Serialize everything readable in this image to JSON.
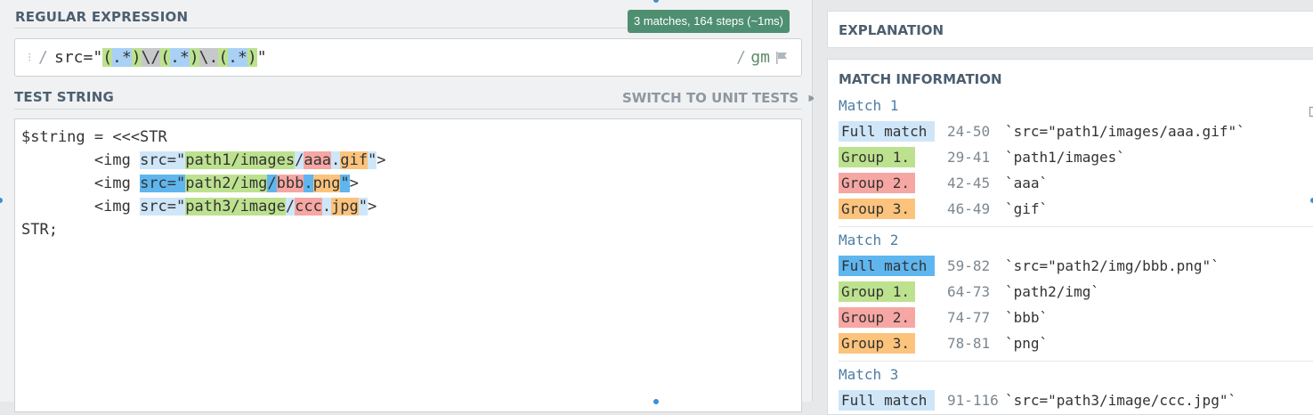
{
  "regex_section": {
    "label": "REGULAR EXPRESSION",
    "match_badge": "3 matches, 164 steps (~1ms)",
    "delimiter_open": "/",
    "delimiter_close": "/",
    "pattern_parts": [
      {
        "text": "src=\"",
        "style": "plain"
      },
      {
        "text": "(",
        "style": "green"
      },
      {
        "text": ".*",
        "style": "blue"
      },
      {
        "text": ")",
        "style": "green"
      },
      {
        "text": "\\/",
        "style": "gray"
      },
      {
        "text": "(",
        "style": "green"
      },
      {
        "text": ".*",
        "style": "blue"
      },
      {
        "text": ")",
        "style": "green"
      },
      {
        "text": "\\.",
        "style": "gray"
      },
      {
        "text": "(",
        "style": "green"
      },
      {
        "text": ".*",
        "style": "blue"
      },
      {
        "text": ")",
        "style": "green"
      },
      {
        "text": "\"",
        "style": "plain"
      }
    ],
    "flags": "gm"
  },
  "test_section": {
    "label": "TEST STRING",
    "switch_label": "SWITCH TO UNIT TESTS",
    "lines": [
      [
        {
          "text": "$string = <<<STR",
          "s": ""
        }
      ],
      [
        {
          "text": "        <img ",
          "s": ""
        },
        {
          "text": "src=\"",
          "s": "m"
        },
        {
          "text": "path1/images",
          "s": "g1"
        },
        {
          "text": "/",
          "s": "m"
        },
        {
          "text": "aaa",
          "s": "g2"
        },
        {
          "text": ".",
          "s": "m"
        },
        {
          "text": "gif",
          "s": "g3"
        },
        {
          "text": "\"",
          "s": "m"
        },
        {
          "text": ">",
          "s": ""
        }
      ],
      [
        {
          "text": "        <img ",
          "s": ""
        },
        {
          "text": "src=\"",
          "s": "mf"
        },
        {
          "text": "path2/img",
          "s": "g1"
        },
        {
          "text": "/",
          "s": "mf"
        },
        {
          "text": "bbb",
          "s": "g2"
        },
        {
          "text": ".",
          "s": "mf"
        },
        {
          "text": "png",
          "s": "g3"
        },
        {
          "text": "\"",
          "s": "mf"
        },
        {
          "text": ">",
          "s": ""
        }
      ],
      [
        {
          "text": "        <img ",
          "s": ""
        },
        {
          "text": "src=\"",
          "s": "m"
        },
        {
          "text": "path3/image",
          "s": "g1"
        },
        {
          "text": "/",
          "s": "m"
        },
        {
          "text": "ccc",
          "s": "g2"
        },
        {
          "text": ".",
          "s": "m"
        },
        {
          "text": "jpg",
          "s": "g3"
        },
        {
          "text": "\"",
          "s": "m"
        },
        {
          "text": ">",
          "s": ""
        }
      ],
      [
        {
          "text": "STR;",
          "s": ""
        }
      ]
    ]
  },
  "explanation": {
    "label": "EXPLANATION"
  },
  "match_info": {
    "label": "MATCH INFORMATION",
    "matches": [
      {
        "title": "Match 1",
        "rows": [
          {
            "label": "Full match",
            "range": "24-50",
            "value": "`src=\"path1/images/aaa.gif\"`",
            "kind": "full"
          },
          {
            "label": "Group 1.",
            "range": "29-41",
            "value": "`path1/images`",
            "kind": "g1"
          },
          {
            "label": "Group 2.",
            "range": "42-45",
            "value": "`aaa`",
            "kind": "g2"
          },
          {
            "label": "Group 3.",
            "range": "46-49",
            "value": "`gif`",
            "kind": "g3"
          }
        ]
      },
      {
        "title": "Match 2",
        "rows": [
          {
            "label": "Full match",
            "range": "59-82",
            "value": "`src=\"path2/img/bbb.png\"`",
            "kind": "fullactive"
          },
          {
            "label": "Group 1.",
            "range": "64-73",
            "value": "`path2/img`",
            "kind": "g1"
          },
          {
            "label": "Group 2.",
            "range": "74-77",
            "value": "`bbb`",
            "kind": "g2"
          },
          {
            "label": "Group 3.",
            "range": "78-81",
            "value": "`png`",
            "kind": "g3"
          }
        ]
      },
      {
        "title": "Match 3",
        "rows": [
          {
            "label": "Full match",
            "range": "91-116",
            "value": "`src=\"path3/image/ccc.jpg\"`",
            "kind": "full"
          }
        ]
      }
    ]
  },
  "colors": {
    "badge": "#4e8f71",
    "group1": "#bde28f",
    "group2": "#f6a7a3",
    "group3": "#fcc37c",
    "full_match": "#cfe6f9",
    "full_match_active": "#5fb6ef"
  },
  "icons": {
    "flag": "flag-icon",
    "share": "share-icon",
    "grip": "grip-icon",
    "chevron": "chevron-right-icon"
  }
}
